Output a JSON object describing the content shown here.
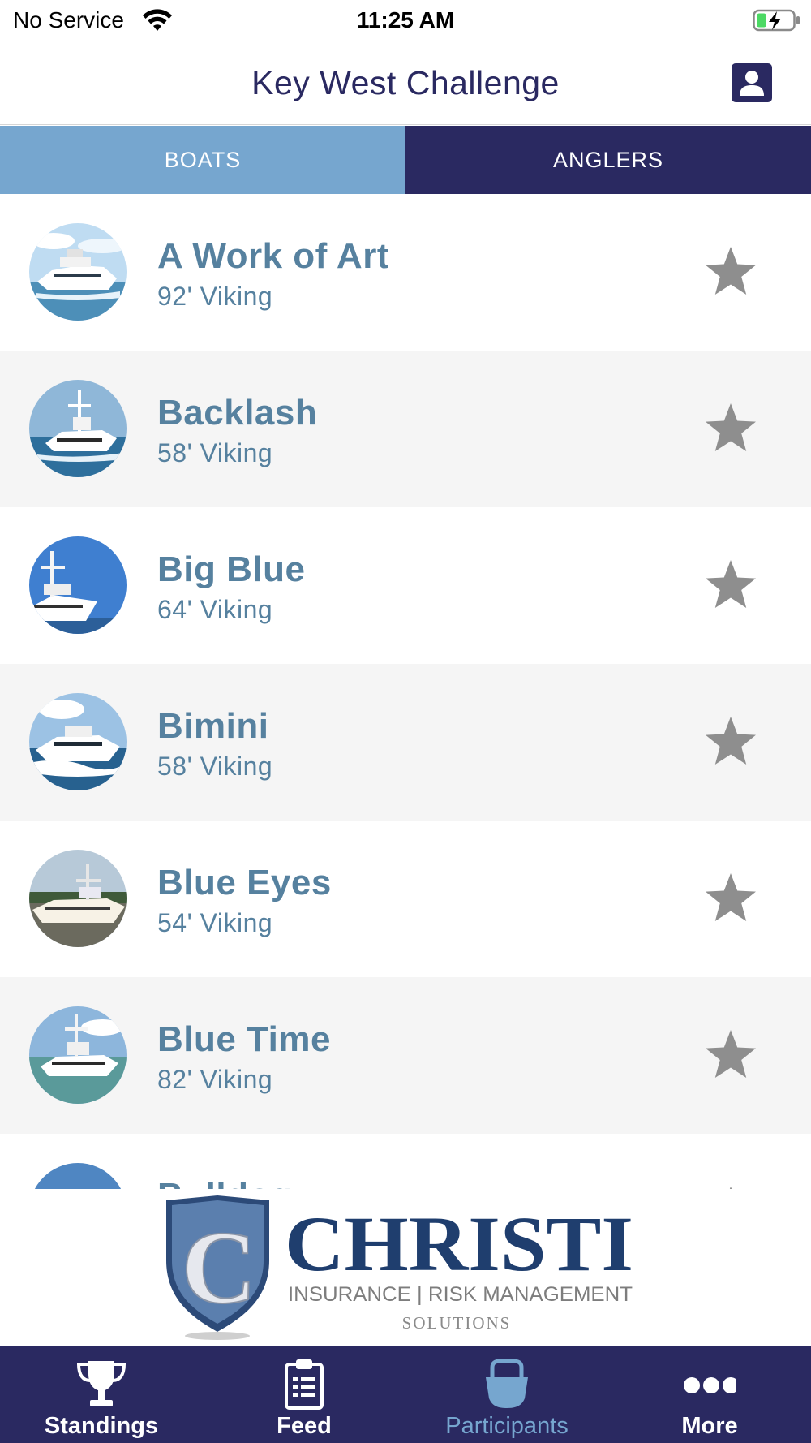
{
  "status_bar": {
    "carrier": "No Service",
    "time": "11:25 AM"
  },
  "header": {
    "title": "Key West Challenge"
  },
  "tabs": [
    {
      "label": "BOATS",
      "active": true
    },
    {
      "label": "ANGLERS",
      "active": false
    }
  ],
  "boats": [
    {
      "name": "A Work of Art",
      "desc": "92' Viking"
    },
    {
      "name": "Backlash",
      "desc": "58' Viking"
    },
    {
      "name": "Big Blue",
      "desc": "64' Viking"
    },
    {
      "name": "Bimini",
      "desc": "58' Viking"
    },
    {
      "name": "Blue Eyes",
      "desc": "54' Viking"
    },
    {
      "name": "Blue Time",
      "desc": "82' Viking"
    },
    {
      "name": "Bulldog",
      "desc": ""
    }
  ],
  "sponsor": {
    "name": "CHRISTI",
    "tagline": "INSURANCE | RISK MANAGEMENT",
    "sub": "SOLUTIONS",
    "logo_letter": "C"
  },
  "tabbar": [
    {
      "label": "Standings",
      "icon": "trophy-icon",
      "active": false
    },
    {
      "label": "Feed",
      "icon": "clipboard-icon",
      "active": false
    },
    {
      "label": "Participants",
      "icon": "boat-icon",
      "active": true
    },
    {
      "label": "More",
      "icon": "more-dots-icon",
      "active": false
    }
  ],
  "colors": {
    "navy": "#2a2961",
    "light_blue": "#76a6cf",
    "boat_text": "#56819f",
    "star_grey": "#8e8e8e"
  }
}
